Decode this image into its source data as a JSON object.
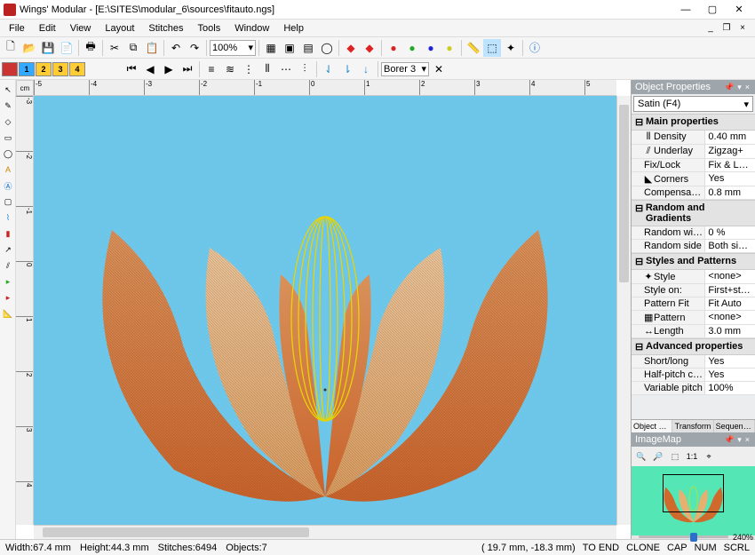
{
  "title": "Wings' Modular - [E:\\SITES\\modular_6\\sources\\fitauto.ngs]",
  "menu": [
    "File",
    "Edit",
    "View",
    "Layout",
    "Stitches",
    "Tools",
    "Window",
    "Help"
  ],
  "zoom": "100%",
  "borer": "Borer 3",
  "ruler_unit": "cm",
  "ruler_h": [
    "-5",
    "-4",
    "-3",
    "-2",
    "-1",
    "0",
    "1",
    "2",
    "3",
    "4",
    "5"
  ],
  "ruler_v": [
    "-3",
    "-2",
    "-1",
    "0",
    "1",
    "2",
    "3",
    "4"
  ],
  "clr": [
    "",
    "1",
    "2",
    "3",
    "4"
  ],
  "op": {
    "title": "Object Properties",
    "combo": "Satin (F4)",
    "g1": "Main properties",
    "r1n": "Density",
    "r1v": "0.40 mm",
    "r2n": "Underlay",
    "r2v": "Zigzag+",
    "r3n": "Fix/Lock",
    "r3v": "Fix & Lock",
    "r4n": "Corners",
    "r4v": "Yes",
    "r5n": "Compensation",
    "r5v": "0.8 mm",
    "g2": "Random and Gradients",
    "r6n": "Random width",
    "r6v": "0 %",
    "r7n": "Random side",
    "r7v": "Both sides",
    "g3": "Styles and Patterns",
    "r8n": "Style",
    "r8v": "<none>",
    "r9n": "Style on:",
    "r9v": "First+stretch",
    "r10n": "Pattern Fit",
    "r10v": "Fit Auto",
    "r11n": "Pattern",
    "r11v": "<none>",
    "r12n": "Length",
    "r12v": "3.0 mm",
    "g4": "Advanced properties",
    "r13n": "Short/long",
    "r13v": "Yes",
    "r14n": "Half-pitch co...",
    "r14v": "Yes",
    "r15n": "Variable pitch",
    "r15v": "100%"
  },
  "tabs": {
    "t1": "Object Prop...",
    "t2": "Transform",
    "t3": "Sequence M..."
  },
  "im": {
    "title": "ImageMap",
    "pct": "240%"
  },
  "status": {
    "w": "Width:67.4 mm",
    "h": "Height:44.3 mm",
    "s": "Stitches:6494",
    "o": "Objects:7",
    "coords": "( 19.7 mm, -18.3 mm)",
    "toend": "TO END",
    "clone": "CLONE",
    "cap": "CAP",
    "num": "NUM",
    "scrl": "SCRL"
  }
}
